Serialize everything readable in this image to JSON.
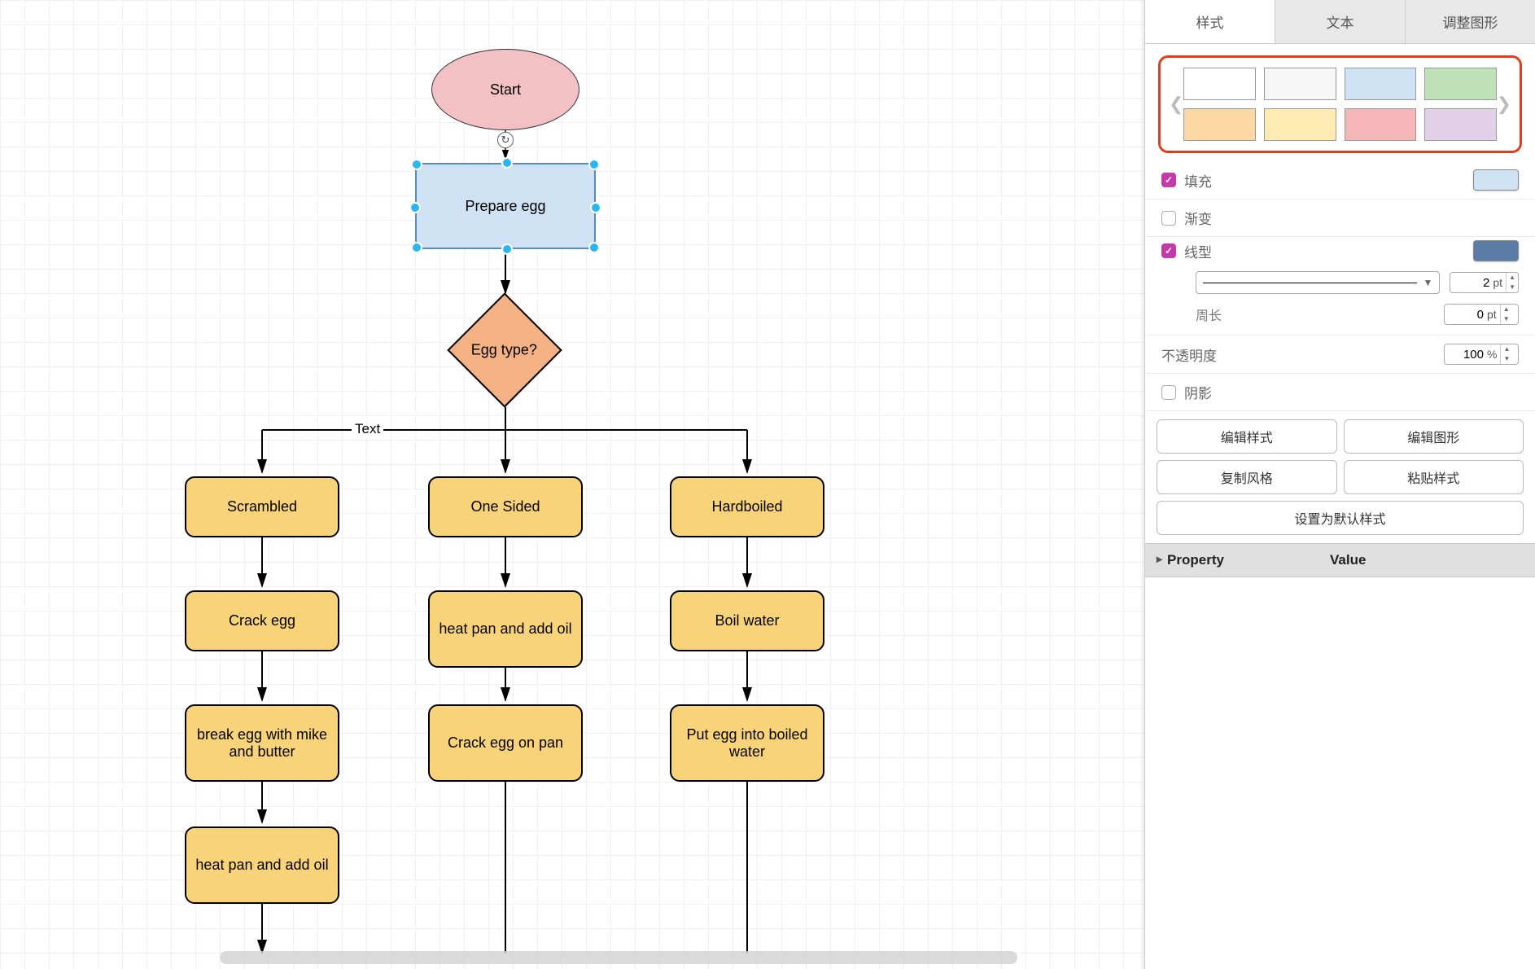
{
  "sidebar": {
    "tabs": {
      "style": "样式",
      "text": "文本",
      "arrange": "调整图形"
    },
    "swatches": {
      "row1": [
        "#ffffff",
        "#f6f6f6",
        "#cfe2f3",
        "#bfe2b8"
      ],
      "row2": [
        "#fcd9a4",
        "#fdebb3",
        "#f4b6b6",
        "#e2cfe8"
      ]
    },
    "fill": {
      "label": "填充",
      "checked": true,
      "color": "#cfe2f3"
    },
    "gradient": {
      "label": "渐变",
      "checked": false
    },
    "line": {
      "label": "线型",
      "checked": true,
      "color": "#5a7ca6",
      "width": "2",
      "width_unit": "pt"
    },
    "perimeter": {
      "label": "周长",
      "value": "0",
      "unit": "pt"
    },
    "opacity": {
      "label": "不透明度",
      "value": "100",
      "unit": "%"
    },
    "shadow": {
      "label": "阴影",
      "checked": false
    },
    "buttons": {
      "edit_style": "编辑样式",
      "edit_shape": "编辑图形",
      "copy_style": "复制风格",
      "paste_style": "粘贴样式",
      "set_default": "设置为默认样式"
    },
    "props": {
      "property": "Property",
      "value": "Value"
    }
  },
  "flow": {
    "start": "Start",
    "prepare": "Prepare egg",
    "decision": "Egg type?",
    "edge_text": "Text",
    "col1": {
      "a": "Scrambled",
      "b": "Crack egg",
      "c": "break egg with mike and butter",
      "d": "heat pan and add oil"
    },
    "col2": {
      "a": "One Sided",
      "b": "heat pan and add oil",
      "c": "Crack egg on pan"
    },
    "col3": {
      "a": "Hardboiled",
      "b": "Boil water",
      "c": "Put egg into boiled water"
    }
  }
}
